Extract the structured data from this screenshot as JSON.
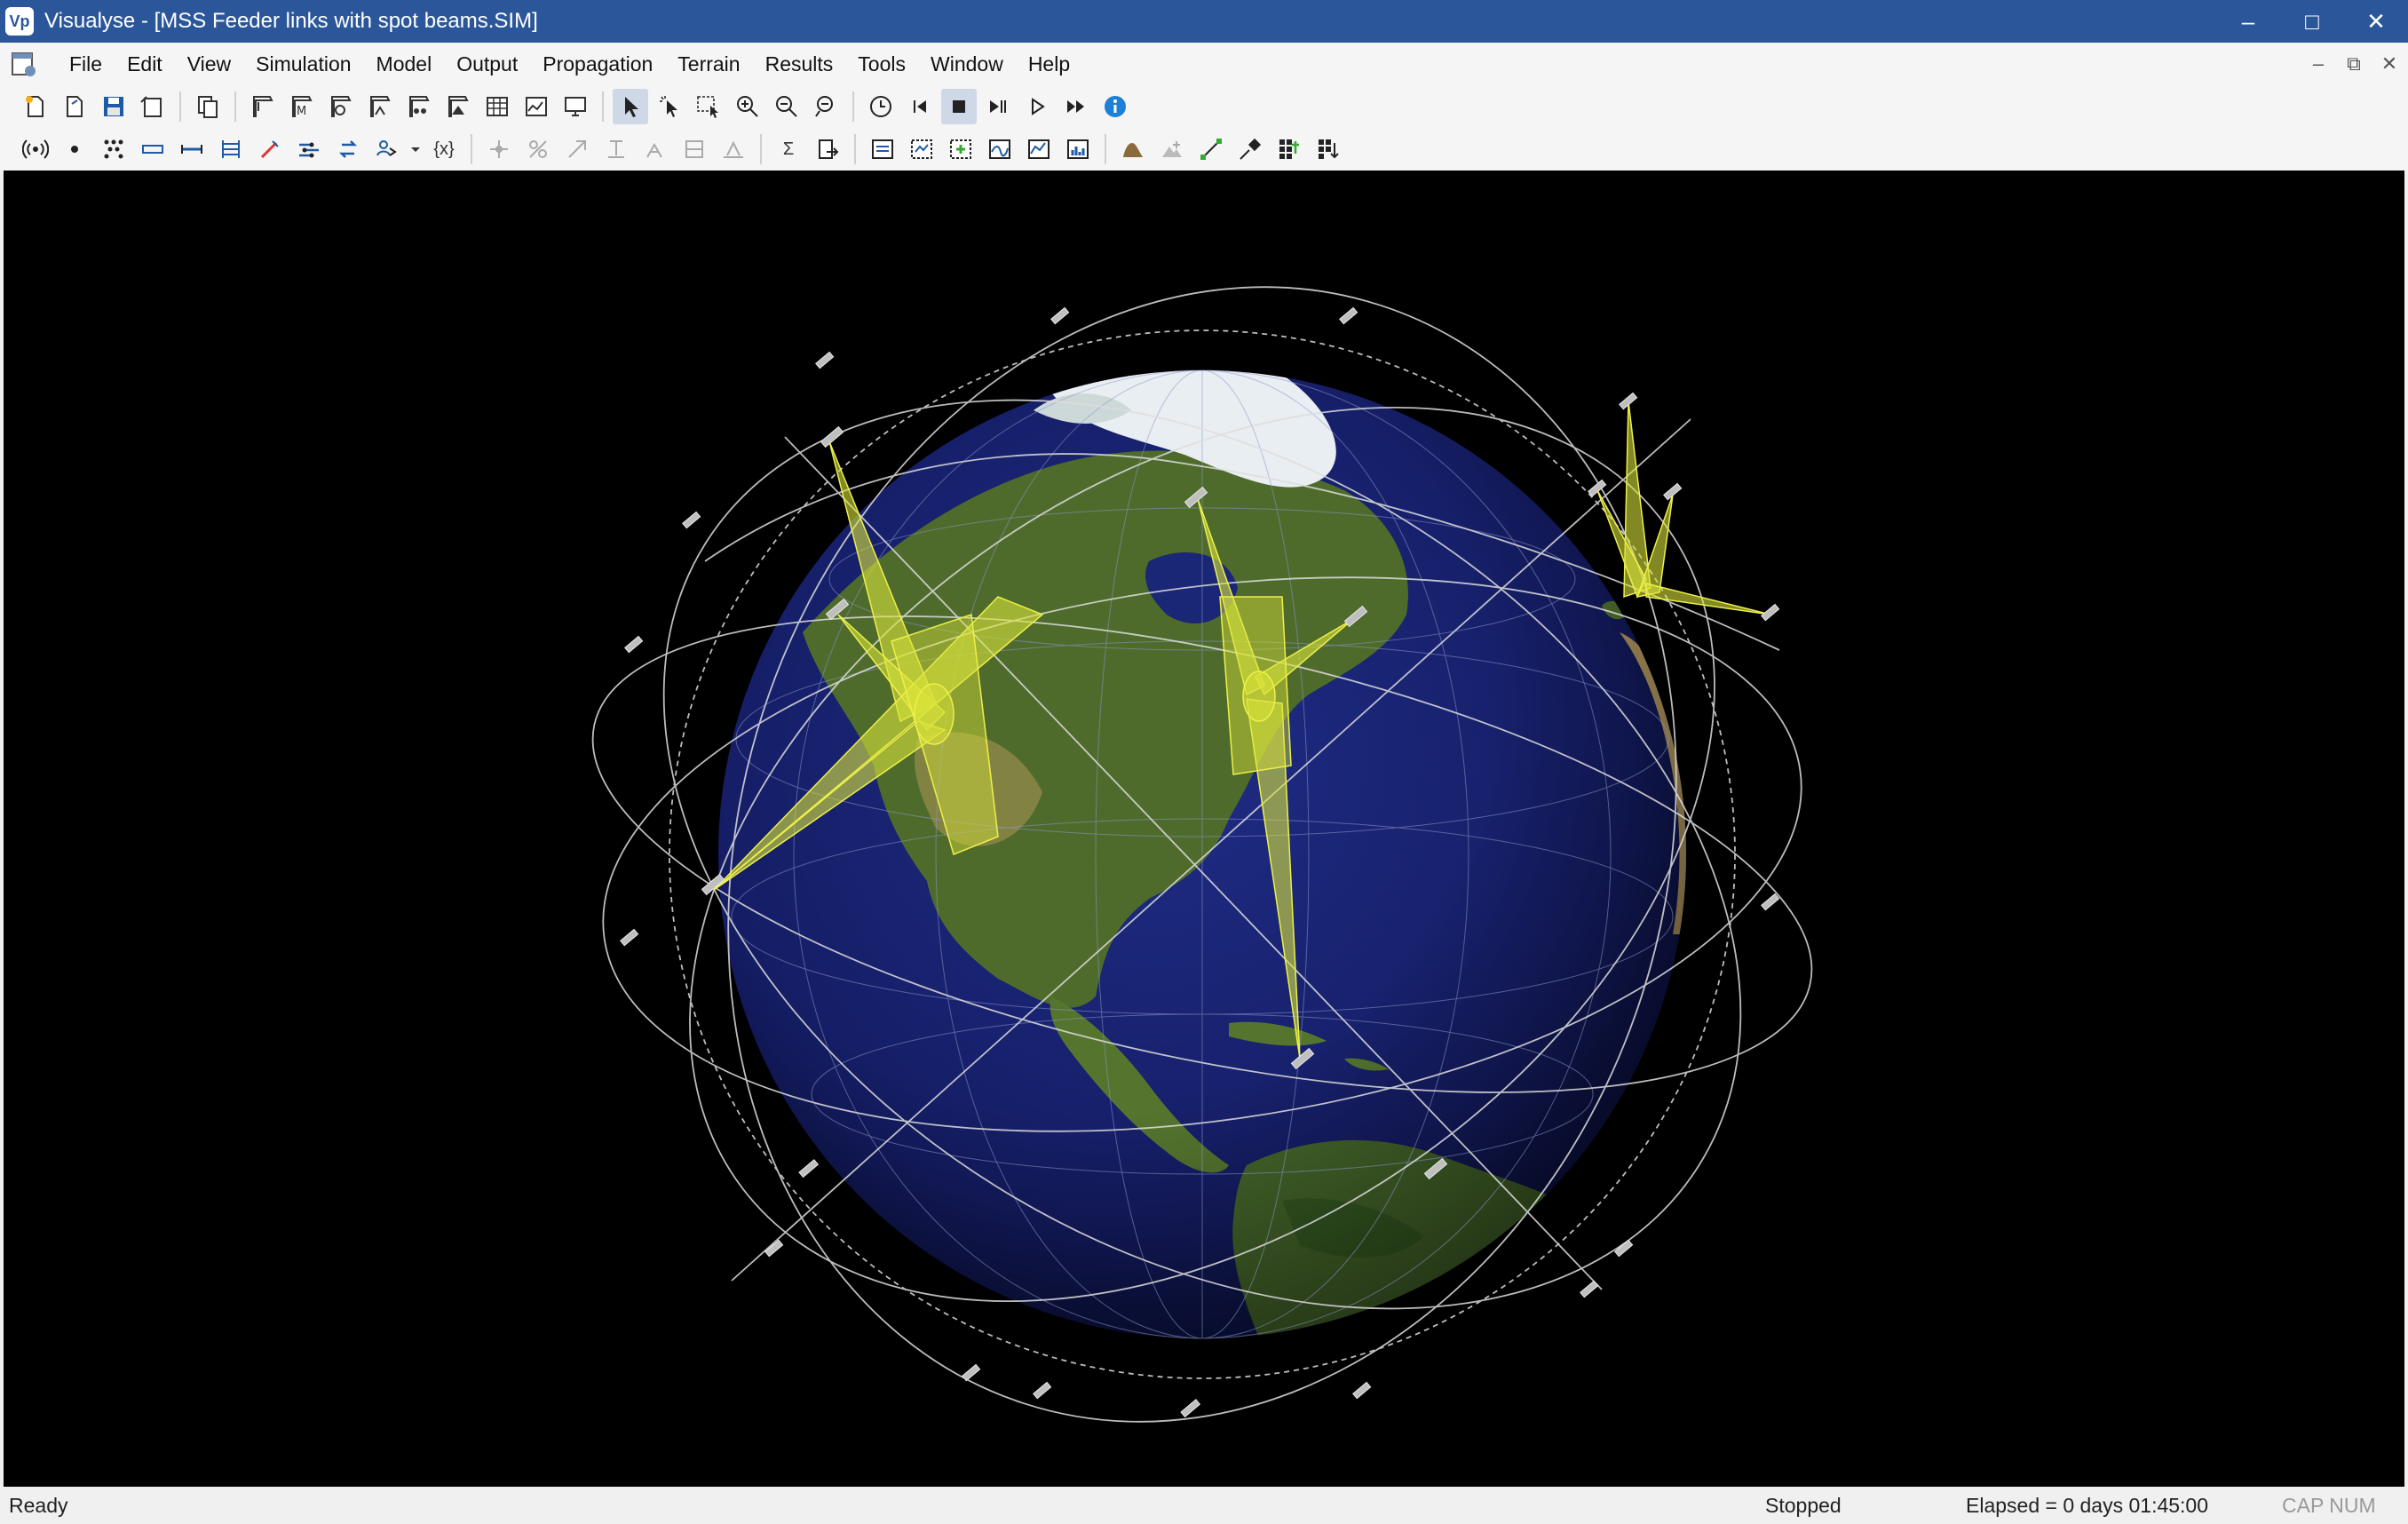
{
  "window": {
    "app_icon_text": "Vp",
    "title": "Visualyse - [MSS Feeder links with spot beams.SIM]",
    "controls": {
      "minimize": "–",
      "maximize": "□",
      "close": "✕"
    }
  },
  "menu": {
    "items": [
      "File",
      "Edit",
      "View",
      "Simulation",
      "Model",
      "Output",
      "Propagation",
      "Terrain",
      "Results",
      "Tools",
      "Window",
      "Help"
    ],
    "mdi": {
      "minimize": "–",
      "restore": "⧉",
      "close": "✕"
    }
  },
  "toolbar": {
    "variables_label": "{x}",
    "sum_label": "Σ"
  },
  "icons": {
    "toolbar1": [
      "new-icon",
      "open-icon",
      "save-icon",
      "save-as-icon",
      "copy-icon",
      "view-1-icon",
      "view-2-icon",
      "view-3-icon",
      "view-4-icon",
      "view-5-icon",
      "view-6-icon",
      "table-icon",
      "graph-icon",
      "monitor-icon",
      "pointer-icon",
      "select-icon",
      "zoom-box-icon",
      "zoom-in-icon",
      "zoom-out-icon",
      "zoom-fit-icon",
      "clock-icon",
      "step-back-icon",
      "stop-icon",
      "pause-step-icon",
      "play-icon",
      "fast-forward-icon",
      "info-icon"
    ],
    "toolbar2": [
      "antenna-icon",
      "station-icon",
      "constellation-icon",
      "link-icon",
      "link-2-icon",
      "carrier-icon",
      "beam-icon",
      "network-icon",
      "swap-icon",
      "group-icon",
      "variables-icon",
      "tool-1-icon",
      "tool-2-icon",
      "tool-3-icon",
      "tool-4-icon",
      "tool-5-icon",
      "tool-6-icon",
      "tool-7-icon",
      "sum-icon",
      "export-icon",
      "chart-1-icon",
      "chart-2-icon",
      "chart-3-icon",
      "chart-4-icon",
      "chart-5-icon",
      "chart-6-icon",
      "terrain-icon",
      "terrain-2-icon",
      "measure-icon",
      "satellite-icon",
      "grid-icon",
      "ruler-icon"
    ]
  },
  "colors": {
    "titlebar": "#2b579a",
    "beam_fill": "#d8e23a",
    "orbit": "#dddddd",
    "ocean": "#16206a",
    "land": "#4f6b2c"
  },
  "status": {
    "ready": "Ready",
    "state": "Stopped",
    "elapsed": "Elapsed = 0 days 01:45:00",
    "keys": "CAP NUM"
  }
}
